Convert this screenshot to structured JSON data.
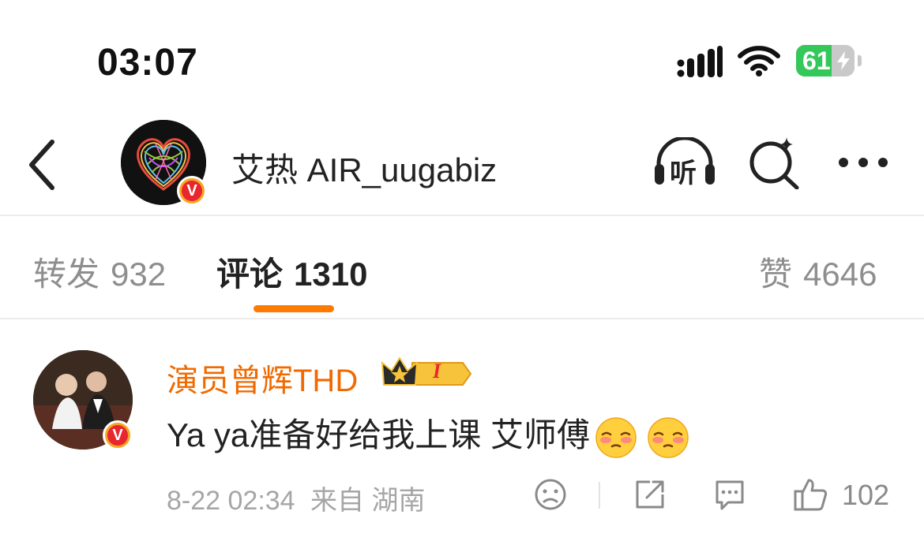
{
  "status_bar": {
    "time": "03:07",
    "battery": "61",
    "battery_level": 0.61
  },
  "header": {
    "title": "艾热 AIR_uugabiz",
    "listen_label": "听",
    "verified_label": "V"
  },
  "tabs": [
    {
      "label": "转发",
      "count": "932"
    },
    {
      "label": "评论",
      "count": "1310"
    },
    {
      "label": "赞",
      "count": "4646"
    }
  ],
  "comment": {
    "user": "演员曾辉THD",
    "member_level": "I",
    "text": "Ya ya准备好给我上课 艾师傅",
    "timestamp": "8-22 02:34",
    "source": "来自 湖南",
    "likes": "102",
    "verified_label": "V"
  },
  "colors": {
    "accent": "#ff7a00",
    "username": "#f06a00",
    "battery_green": "#34c759",
    "verified_red": "#e8262d"
  },
  "icons": [
    "back-chevron-icon",
    "headphones-listen-icon",
    "search-sparkle-icon",
    "more-dots-icon",
    "dislike-face-icon",
    "share-icon",
    "comment-icon",
    "thumbs-up-icon",
    "crown-icon",
    "blush-emoji-icon"
  ]
}
